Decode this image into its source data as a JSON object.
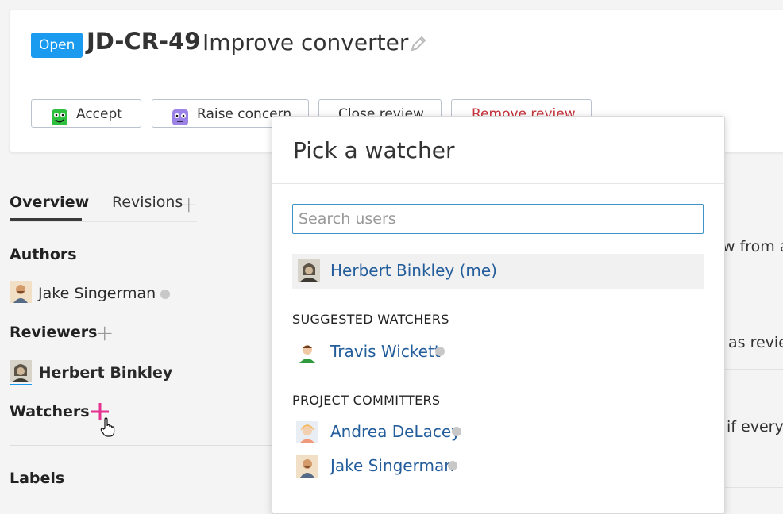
{
  "review": {
    "status": "Open",
    "id": "JD-CR-49",
    "title": "Improve converter"
  },
  "actions": {
    "accept": "Accept",
    "raise_concern": "Raise concern",
    "close_review": "Close review",
    "remove_review": "Remove review"
  },
  "tabs": {
    "overview": "Overview",
    "revisions": "Revisions"
  },
  "sidebar": {
    "authors_label": "Authors",
    "author": "Jake Singerman",
    "reviewers_label": "Reviewers",
    "reviewer": "Herbert Binkley",
    "watchers_label": "Watchers",
    "labels_label": "Labels"
  },
  "background_fragments": {
    "line1": "w from a",
    "line2": "as revie",
    "line3": "if everyt"
  },
  "popup": {
    "title": "Pick a watcher",
    "search_placeholder": "Search users",
    "me": "Herbert Binkley (me)",
    "suggested_heading": "SUGGESTED WATCHERS",
    "suggested": [
      "Travis Wickett"
    ],
    "committers_heading": "PROJECT COMMITTERS",
    "committers": [
      "Andrea DeLacey",
      "Jake Singerman"
    ]
  },
  "colors": {
    "status_badge": "#1a9bf0",
    "link": "#235d9c",
    "remove_text": "#c6323a",
    "watchers_plus": "#e5318f"
  },
  "icons": [
    "pencil-icon",
    "accept-emoji-icon",
    "concern-emoji-icon",
    "plus-icon",
    "hand-cursor-icon"
  ]
}
